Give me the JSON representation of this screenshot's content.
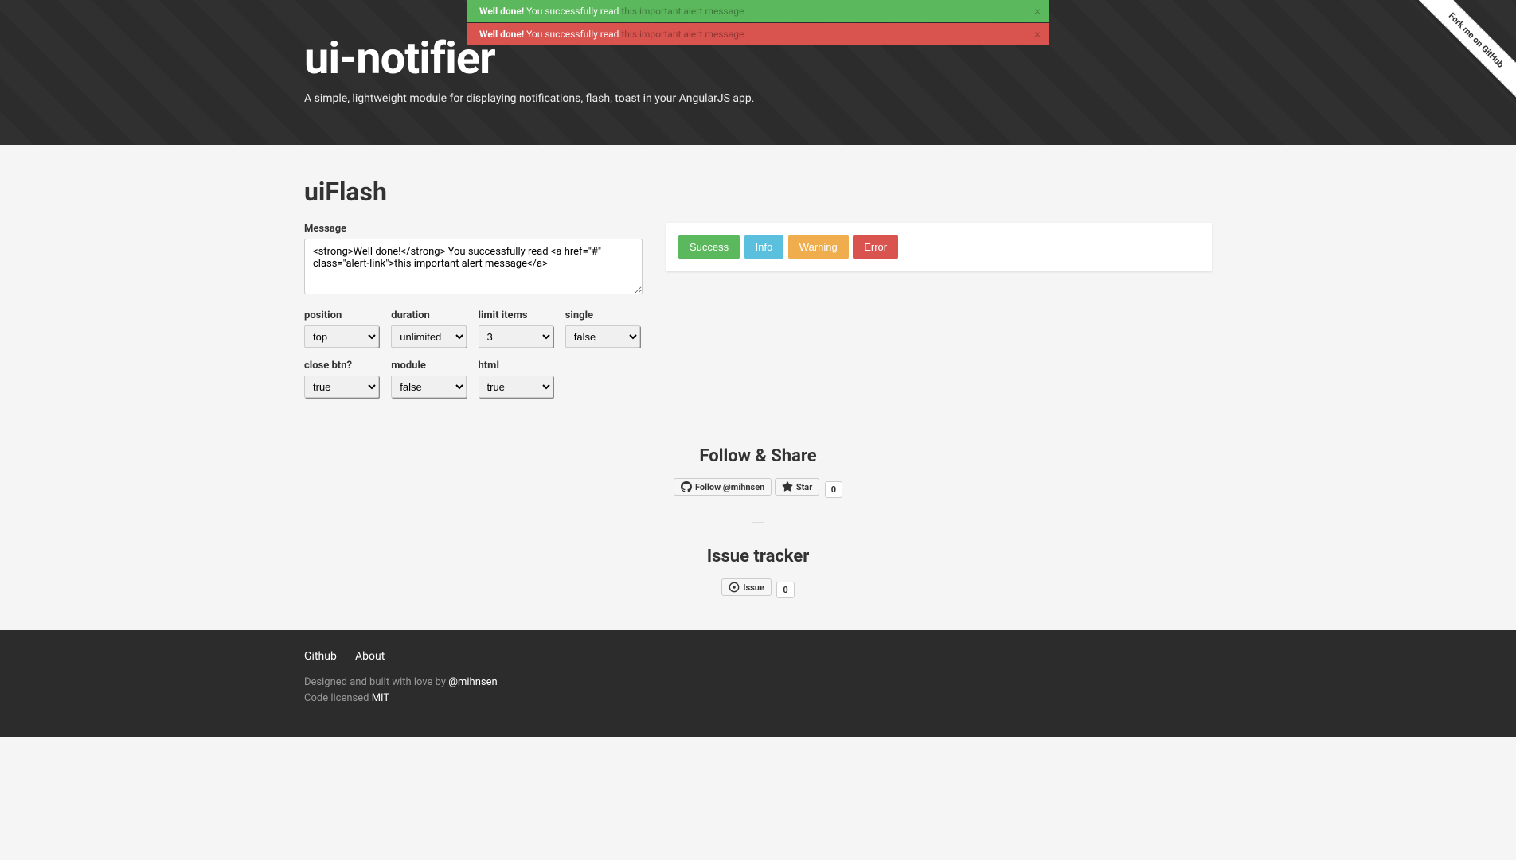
{
  "header": {
    "title": "ui-notifier",
    "subtitle": "A simple, lightweight module for displaying notifications, flash, toast in your AngularJS app.",
    "fork_label": "Fork me on GitHub"
  },
  "alerts": [
    {
      "type": "success",
      "strong": "Well done!",
      "text": " You successfully read ",
      "link": "this important alert message"
    },
    {
      "type": "danger",
      "strong": "Well done!",
      "text": " You successfully read ",
      "link": "this important alert message"
    }
  ],
  "main": {
    "section_title": "uiFlash",
    "message_label": "Message",
    "message_value": "<strong>Well done!</strong> You successfully read <a href=\"#\" class=\"alert-link\">this important alert message</a>",
    "options": [
      {
        "label": "position",
        "value": "top"
      },
      {
        "label": "duration",
        "value": "unlimited"
      },
      {
        "label": "limit items",
        "value": "3"
      },
      {
        "label": "single",
        "value": "false"
      },
      {
        "label": "close btn?",
        "value": "true"
      },
      {
        "label": "module",
        "value": "false"
      },
      {
        "label": "html",
        "value": "true"
      }
    ],
    "buttons": {
      "success": "Success",
      "info": "Info",
      "warning": "Warning",
      "error": "Error"
    }
  },
  "social": {
    "follow_heading": "Follow & Share",
    "follow_btn": "Follow @mihnsen",
    "star_btn": "Star",
    "star_count": "0",
    "issue_heading": "Issue tracker",
    "issue_btn": "Issue",
    "issue_count": "0"
  },
  "footer": {
    "nav": {
      "github": "Github",
      "about": "About"
    },
    "designed_prefix": "Designed and built with love by ",
    "designed_link": "@mihnsen",
    "license_prefix": "Code licensed ",
    "license_link": "MIT"
  }
}
